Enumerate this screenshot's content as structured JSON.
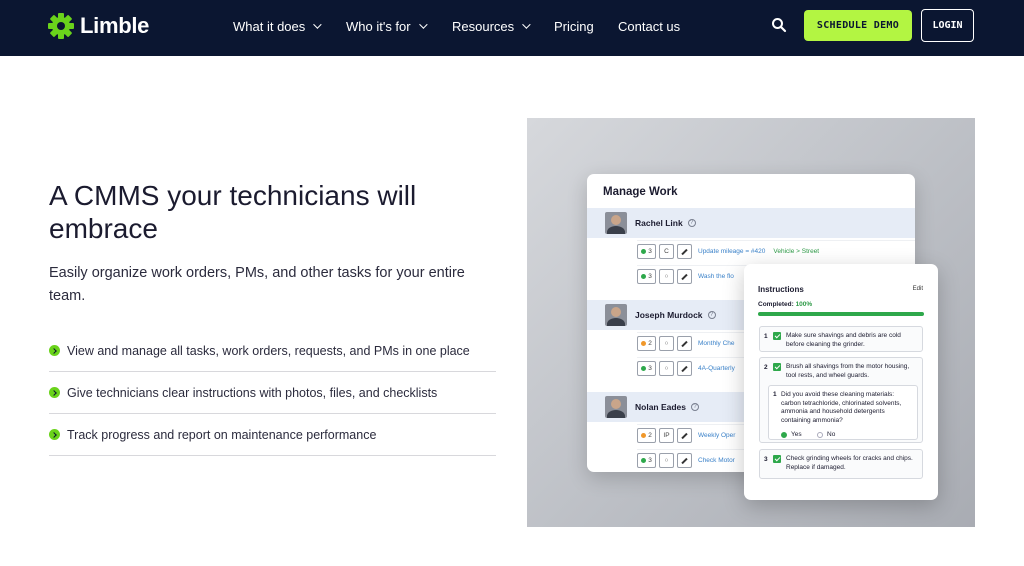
{
  "nav": {
    "logo_text": "Limble",
    "links": [
      {
        "label": "What it does",
        "dropdown": true
      },
      {
        "label": "Who it's for",
        "dropdown": true
      },
      {
        "label": "Resources",
        "dropdown": true
      },
      {
        "label": "Pricing",
        "dropdown": false
      },
      {
        "label": "Contact us",
        "dropdown": false
      }
    ],
    "demo_label": "SCHEDULE DEMO",
    "login_label": "LOGIN"
  },
  "hero": {
    "headline": "A CMMS your technicians will embrace",
    "sub": "Easily organize work orders, PMs, and other tasks for your entire team.",
    "features": [
      "View and manage all tasks, work orders, requests, and PMs in one place",
      "Give technicians clear instructions with photos, files, and checklists",
      "Track progress and report on maintenance performance"
    ]
  },
  "mockup": {
    "manage_title": "Manage Work",
    "people": [
      {
        "name": "Rachel Link",
        "tasks": [
          {
            "count": "3",
            "status_color": "#2ea84b",
            "type": "C",
            "text": "Update mileage = #420",
            "asset": "Vehicle > Street"
          },
          {
            "count": "3",
            "status_color": "#2ea84b",
            "type": "",
            "text": "Wash the flo",
            "asset": ""
          }
        ]
      },
      {
        "name": "Joseph Murdock",
        "tasks": [
          {
            "count": "2",
            "status_color": "#f0982b",
            "type": "",
            "text": "Monthly Che",
            "asset": ""
          },
          {
            "count": "3",
            "status_color": "#2ea84b",
            "type": "",
            "text": "4A-Quarterly",
            "asset": ""
          }
        ]
      },
      {
        "name": "Nolan Eades",
        "tasks": [
          {
            "count": "2",
            "status_color": "#f0982b",
            "type": "IP",
            "text": "Weekly Oper",
            "asset": ""
          },
          {
            "count": "3",
            "status_color": "#2ea84b",
            "type": "",
            "text": "Check Motor",
            "asset": ""
          }
        ]
      }
    ],
    "instructions": {
      "title": "Instructions",
      "edit": "Edit",
      "completed_label": "Completed:",
      "completed_value": "100%",
      "progress": 1.0,
      "steps": [
        {
          "num": "1",
          "text": "Make sure shavings and debris are cold before cleaning the grinder."
        },
        {
          "num": "2",
          "text": "Brush all shavings from the motor housing, tool rests, and wheel guards."
        },
        {
          "num": "3",
          "text": "Check grinding wheels for cracks and chips. Replace if damaged."
        }
      ],
      "sub_question": {
        "num": "1",
        "text": "Did you avoid these cleaning materials: carbon tetrachloride, chlorinated solvents, ammonia and household detergents containing ammonia?",
        "yes": "Yes",
        "no": "No"
      }
    }
  },
  "colors": {
    "nav_bg": "#0b1631",
    "accent": "#b3f542",
    "check": "#6ad31b",
    "link_blue": "#3b82c9",
    "success": "#2ea84b"
  }
}
